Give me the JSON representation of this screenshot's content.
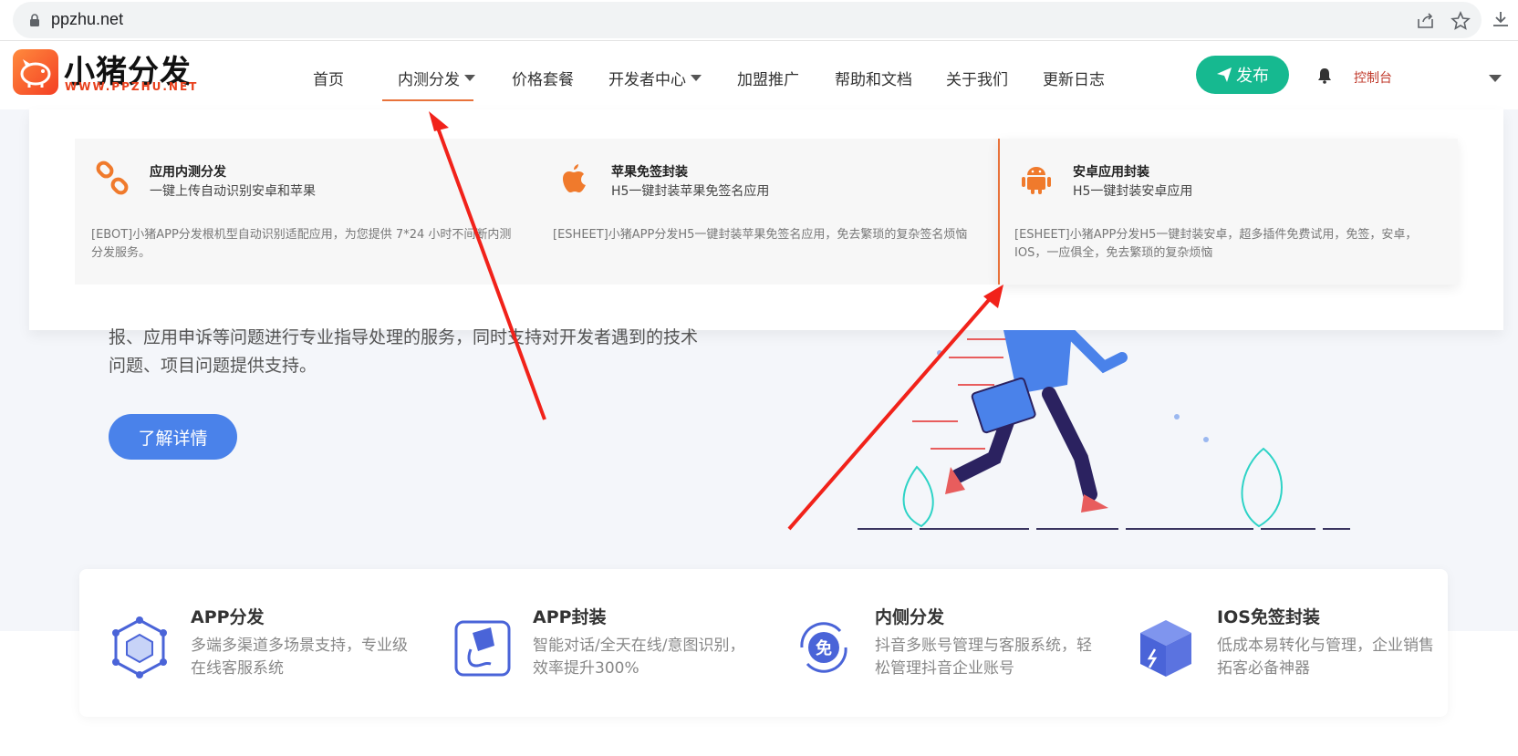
{
  "browser": {
    "url": "ppzhu.net",
    "icons": [
      "lock-icon",
      "share-icon",
      "star-icon",
      "download-icon"
    ]
  },
  "header": {
    "logo_title": "小猪分发",
    "logo_subtitle": "WWW.PPZHU.NET",
    "nav": [
      {
        "label": "首页",
        "has_caret": false
      },
      {
        "label": "内测分发",
        "has_caret": true,
        "active": true
      },
      {
        "label": "价格套餐",
        "has_caret": false
      },
      {
        "label": "开发者中心",
        "has_caret": true
      },
      {
        "label": "加盟推广",
        "has_caret": false
      },
      {
        "label": "帮助和文档",
        "has_caret": false
      },
      {
        "label": "关于我们",
        "has_caret": false
      },
      {
        "label": "更新日志",
        "has_caret": false
      }
    ],
    "publish_label": "发布",
    "console_label": "控制台",
    "accent": "#16b990"
  },
  "mega_menu": {
    "cards": [
      {
        "icon": "link-icon",
        "title": "应用内测分发",
        "subtitle": "一键上传自动识别安卓和苹果",
        "desc": "[EBOT]小猪APP分发根机型自动识别适配应用，为您提供 7*24 小时不间断内测分发服务。"
      },
      {
        "icon": "apple-icon",
        "title": "苹果免签封装",
        "subtitle": "H5一键封装苹果免签名应用",
        "desc": "[ESHEET]小猪APP分发H5一键封装苹果免签名应用，免去繁琐的复杂签名烦恼"
      },
      {
        "icon": "android-icon",
        "title": "安卓应用封装",
        "subtitle": "H5一键封装安卓应用",
        "desc": "[ESHEET]小猪APP分发H5一键封装安卓，超多插件免费试用，免签，安卓，IOS，一应俱全，免去繁琐的复杂烦恼"
      }
    ]
  },
  "hero": {
    "text_line1": "报、应用申诉等问题进行专业指导处理的服务，同时支持对开发者遇到的技术",
    "text_line2": "问题、项目问题提供支持。",
    "button_label": "了解详情"
  },
  "features": [
    {
      "icon": "cube-network-icon",
      "title": "APP分发",
      "desc": "多端多渠道多场景支持，专业级在线客服系统"
    },
    {
      "icon": "paint-bucket-icon",
      "title": "APP封装",
      "desc": "智能对话/全天在线/意图识别，效率提升300%"
    },
    {
      "icon": "free-badge-icon",
      "title": "内侧分发",
      "desc": "抖音多账号管理与客服系统，轻松管理抖音企业账号"
    },
    {
      "icon": "box-icon",
      "title": "IOS免签封装",
      "desc": "低成本易转化与管理，企业销售拓客必备神器"
    }
  ]
}
